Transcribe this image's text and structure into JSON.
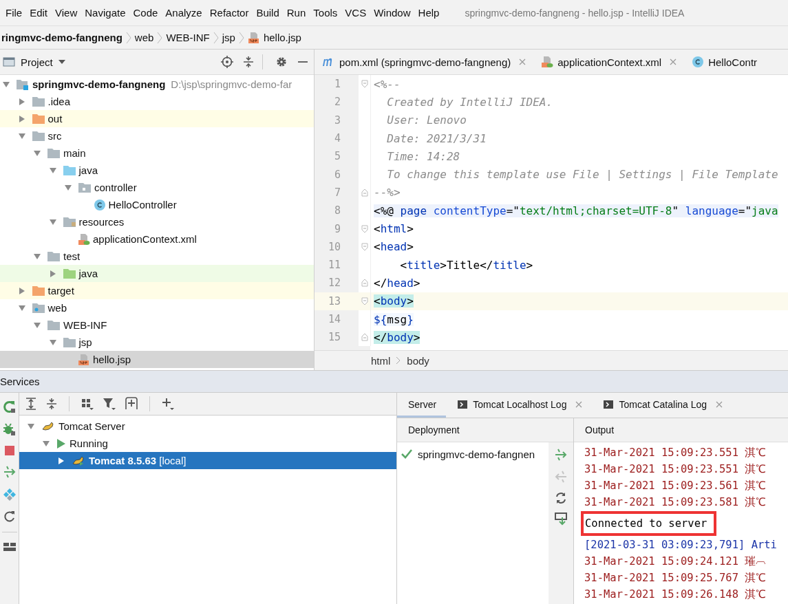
{
  "menu": [
    "File",
    "Edit",
    "View",
    "Navigate",
    "Code",
    "Analyze",
    "Refactor",
    "Build",
    "Run",
    "Tools",
    "VCS",
    "Window",
    "Help"
  ],
  "window": {
    "title": "springmvc-demo-fangneng - hello.jsp - IntelliJ IDEA"
  },
  "breadcrumb": [
    {
      "label": "ringmvc-demo-fangneng",
      "kind": "module"
    },
    {
      "label": "web",
      "kind": "folder"
    },
    {
      "label": "WEB-INF",
      "kind": "folder"
    },
    {
      "label": "jsp",
      "kind": "folder"
    },
    {
      "label": "hello.jsp",
      "kind": "jsp"
    }
  ],
  "project": {
    "title": "Project",
    "tree": [
      {
        "name": "springmvc-demo-fangneng",
        "path": "D:\\jsp\\springmvc-demo-far",
        "kind": "module",
        "expanded": true,
        "selected": false,
        "children": [
          {
            "name": ".idea",
            "kind": "folder",
            "expanded": false,
            "selected": false
          },
          {
            "name": "out",
            "kind": "excluded",
            "expanded": false,
            "selected": false
          },
          {
            "name": "src",
            "kind": "folder",
            "expanded": true,
            "selected": false,
            "children": [
              {
                "name": "main",
                "kind": "folder",
                "expanded": true,
                "selected": false,
                "children": [
                  {
                    "name": "java",
                    "kind": "source",
                    "expanded": true,
                    "selected": false,
                    "children": [
                      {
                        "name": "controller",
                        "kind": "package",
                        "expanded": true,
                        "selected": false,
                        "children": [
                          {
                            "name": "HelloController",
                            "kind": "class",
                            "selected": false
                          }
                        ]
                      }
                    ]
                  },
                  {
                    "name": "resources",
                    "kind": "resources",
                    "expanded": true,
                    "selected": false,
                    "children": [
                      {
                        "name": "applicationContext.xml",
                        "kind": "xml",
                        "selected": false
                      }
                    ]
                  }
                ]
              },
              {
                "name": "test",
                "kind": "folder",
                "expanded": true,
                "selected": false,
                "children": [
                  {
                    "name": "java",
                    "kind": "test",
                    "expanded": false,
                    "selected": false
                  }
                ]
              }
            ]
          },
          {
            "name": "target",
            "kind": "excluded",
            "expanded": false,
            "selected": false
          },
          {
            "name": "web",
            "kind": "web",
            "expanded": true,
            "selected": false,
            "children": [
              {
                "name": "WEB-INF",
                "kind": "folder",
                "expanded": true,
                "selected": false,
                "children": [
                  {
                    "name": "jsp",
                    "kind": "folder",
                    "expanded": true,
                    "selected": false,
                    "children": [
                      {
                        "name": "hello.jsp",
                        "kind": "jsp",
                        "selected": true
                      }
                    ]
                  }
                ]
              }
            ]
          }
        ]
      }
    ]
  },
  "editor": {
    "tabs": [
      {
        "label": "pom.xml (springmvc-demo-fangneng)",
        "kind": "maven",
        "closable": true,
        "selected": false
      },
      {
        "label": "applicationContext.xml",
        "kind": "xml",
        "closable": true,
        "selected": false
      },
      {
        "label": "HelloContr",
        "kind": "class",
        "closable": false,
        "selected": false
      }
    ],
    "lines": [
      {
        "num": "1",
        "kind": "fold-open",
        "current": false,
        "tokens": [
          {
            "kind": "comment",
            "t": "<%--"
          }
        ]
      },
      {
        "num": "2",
        "kind": "plain",
        "current": false,
        "tokens": [
          {
            "kind": "comment",
            "t": "  Created by IntelliJ IDEA."
          }
        ]
      },
      {
        "num": "3",
        "kind": "plain",
        "current": false,
        "tokens": [
          {
            "kind": "comment",
            "t": "  User: Lenovo"
          }
        ]
      },
      {
        "num": "4",
        "kind": "plain",
        "current": false,
        "tokens": [
          {
            "kind": "comment",
            "t": "  Date: 2021/3/31"
          }
        ]
      },
      {
        "num": "5",
        "kind": "plain",
        "current": false,
        "tokens": [
          {
            "kind": "comment",
            "t": "  Time: 14:28"
          }
        ]
      },
      {
        "num": "6",
        "kind": "plain",
        "current": false,
        "tokens": [
          {
            "kind": "comment",
            "t": "  To change this template use File | Settings | File Template"
          }
        ]
      },
      {
        "num": "7",
        "kind": "fold-close",
        "current": false,
        "tokens": [
          {
            "kind": "comment",
            "t": "--%>"
          }
        ]
      },
      {
        "num": "8",
        "kind": "plain",
        "current": false,
        "tokens": [
          {
            "kind": "d",
            "t": "<%@ "
          },
          {
            "kind": "dtag",
            "t": "page "
          },
          {
            "kind": "dattr",
            "t": "contentType"
          },
          {
            "kind": "d",
            "t": "=\""
          },
          {
            "kind": "ds",
            "t": "text/html;charset=UTF-8"
          },
          {
            "kind": "d",
            "t": "\" "
          },
          {
            "kind": "dattr",
            "t": "language"
          },
          {
            "kind": "d",
            "t": "=\""
          },
          {
            "kind": "ds",
            "t": "java"
          }
        ]
      },
      {
        "num": "9",
        "kind": "fold-open",
        "current": false,
        "tokens": [
          {
            "kind": "p",
            "t": "<"
          },
          {
            "kind": "tag",
            "t": "html"
          },
          {
            "kind": "p",
            "t": ">"
          }
        ]
      },
      {
        "num": "10",
        "kind": "fold-open",
        "current": false,
        "tokens": [
          {
            "kind": "p",
            "t": "<"
          },
          {
            "kind": "tag",
            "t": "head"
          },
          {
            "kind": "p",
            "t": ">"
          }
        ]
      },
      {
        "num": "11",
        "kind": "plain",
        "current": false,
        "tokens": [
          {
            "kind": "p",
            "t": "    <"
          },
          {
            "kind": "tag",
            "t": "title"
          },
          {
            "kind": "p",
            "t": ">Title</"
          },
          {
            "kind": "tag",
            "t": "title"
          },
          {
            "kind": "p",
            "t": ">"
          }
        ]
      },
      {
        "num": "12",
        "kind": "fold-close",
        "current": false,
        "tokens": [
          {
            "kind": "p",
            "t": "</"
          },
          {
            "kind": "tag",
            "t": "head"
          },
          {
            "kind": "p",
            "t": ">"
          }
        ]
      },
      {
        "num": "13",
        "kind": "fold-open",
        "current": true,
        "tokens": [
          {
            "kind": "mp",
            "t": "<"
          },
          {
            "kind": "mtag",
            "t": "body"
          },
          {
            "kind": "mp",
            "t": ">"
          }
        ]
      },
      {
        "num": "14",
        "kind": "plain",
        "current": false,
        "tokens": [
          {
            "kind": "el",
            "t": "${"
          },
          {
            "kind": "elv",
            "t": "msg"
          },
          {
            "kind": "el",
            "t": "}"
          }
        ]
      },
      {
        "num": "15",
        "kind": "fold-close",
        "current": false,
        "tokens": [
          {
            "kind": "mp",
            "t": "</"
          },
          {
            "kind": "mtag",
            "t": "body"
          },
          {
            "kind": "mp",
            "t": ">"
          }
        ]
      }
    ],
    "breadcrumb": [
      "html",
      "body"
    ]
  },
  "services": {
    "title": "Services",
    "tree": [
      {
        "label": "Tomcat Server",
        "kind": "tomcat",
        "expanded": true,
        "selected": false,
        "children": [
          {
            "label": "Running",
            "kind": "running",
            "expanded": true,
            "selected": false,
            "children": [
              {
                "label": "**Tomcat 8.5.63** [local]",
                "kind": "tomcat-run",
                "expanded": false,
                "selected": true
              }
            ]
          }
        ]
      }
    ],
    "tabs": [
      {
        "label": "Server",
        "kind": "plain",
        "closable": false,
        "selected": true
      },
      {
        "label": "Tomcat Localhost Log",
        "kind": "log",
        "closable": true,
        "selected": false
      },
      {
        "label": "Tomcat Catalina Log",
        "kind": "log",
        "closable": true,
        "selected": false
      }
    ],
    "deployment": {
      "header": "Deployment",
      "items": [
        {
          "name": "springmvc-demo-fangnen",
          "deployed": true
        }
      ]
    },
    "output": {
      "header": "Output",
      "lines": [
        {
          "kind": "stderr",
          "boxed": false,
          "text": "31-Mar-2021 15:09:23.551 淇℃"
        },
        {
          "kind": "stderr",
          "boxed": false,
          "text": "31-Mar-2021 15:09:23.551 淇℃"
        },
        {
          "kind": "stderr",
          "boxed": false,
          "text": "31-Mar-2021 15:09:23.561 淇℃"
        },
        {
          "kind": "stderr",
          "boxed": false,
          "text": "31-Mar-2021 15:09:23.581 淇℃"
        },
        {
          "kind": "stdout",
          "boxed": true,
          "text": "Connected to server"
        },
        {
          "kind": "system",
          "boxed": false,
          "text": "[2021-03-31 03:09:23,791] Arti"
        },
        {
          "kind": "stderr",
          "boxed": false,
          "text": "31-Mar-2021 15:09:24.121 璀︹"
        },
        {
          "kind": "stderr",
          "boxed": false,
          "text": "31-Mar-2021 15:09:25.767 淇℃"
        },
        {
          "kind": "stderr",
          "boxed": false,
          "text": "31-Mar-2021 15:09:26.148 淇℃"
        }
      ]
    }
  }
}
